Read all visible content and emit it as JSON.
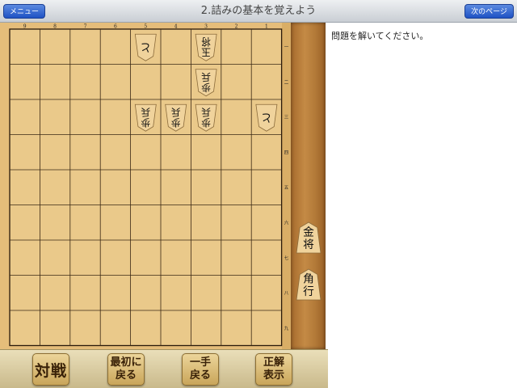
{
  "header": {
    "title": "2.詰みの基本を覚えよう",
    "menu_label": "メニュー",
    "next_label": "次のページ"
  },
  "board": {
    "file_labels": [
      "9",
      "8",
      "7",
      "6",
      "5",
      "4",
      "3",
      "2",
      "1"
    ],
    "rank_labels": [
      "一",
      "二",
      "三",
      "四",
      "五",
      "六",
      "七",
      "八",
      "九"
    ],
    "pieces": [
      {
        "file": 5,
        "rank": 1,
        "label": "と",
        "owner": "opponent"
      },
      {
        "file": 3,
        "rank": 1,
        "label": "玉将",
        "owner": "opponent"
      },
      {
        "file": 3,
        "rank": 2,
        "label": "歩兵",
        "owner": "opponent"
      },
      {
        "file": 5,
        "rank": 3,
        "label": "歩兵",
        "owner": "opponent"
      },
      {
        "file": 4,
        "rank": 3,
        "label": "歩兵",
        "owner": "opponent"
      },
      {
        "file": 3,
        "rank": 3,
        "label": "歩兵",
        "owner": "opponent"
      },
      {
        "file": 1,
        "rank": 3,
        "label": "と",
        "owner": "opponent"
      }
    ]
  },
  "hand": {
    "pieces": [
      {
        "label": "金将"
      },
      {
        "label": "角行"
      }
    ]
  },
  "message": "問題を解いてください。",
  "buttons": {
    "match": "対戦",
    "first": "最初に\n戻る",
    "back": "一手\n戻る",
    "answer": "正解\n表示"
  }
}
